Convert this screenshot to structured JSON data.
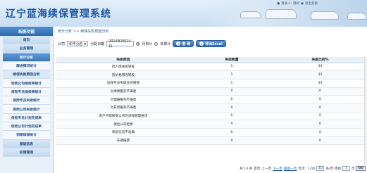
{
  "app": {
    "title": "辽宁蓝海续保管理系统"
  },
  "header_links": {
    "welcome": "登录人: 测试",
    "logout": "退出系统"
  },
  "sidebar": {
    "title": "系统功能",
    "items": [
      {
        "label": "首页",
        "kind": "group"
      },
      {
        "label": "业务管理",
        "kind": "group"
      },
      {
        "label": "统计分析",
        "kind": "active"
      },
      {
        "label": "跟进情况统计",
        "kind": "sub"
      },
      {
        "label": "续保失败原因分析",
        "kind": "sub-active"
      },
      {
        "label": "保险公司续保率统计",
        "kind": "sub"
      },
      {
        "label": "保险专员续保率统计",
        "kind": "sub"
      },
      {
        "label": "保险专员失败统计",
        "kind": "sub"
      },
      {
        "label": "保险公司失败统计",
        "kind": "sub"
      },
      {
        "label": "保险专员计划完成率",
        "kind": "sub"
      },
      {
        "label": "保险公司计划完成率",
        "kind": "sub"
      },
      {
        "label": "到期续保统计",
        "kind": "sub"
      },
      {
        "label": "基础信息",
        "kind": "group"
      },
      {
        "label": "权限管理",
        "kind": "group"
      }
    ]
  },
  "breadcrumb": {
    "parent": "统计分析",
    "sep": ">>",
    "current": "续保失败原因分析"
  },
  "filter": {
    "company_label": "公司",
    "company_value": "和平分店",
    "date_label": "分配日期",
    "date_value": "2014年3月24日",
    "mode_month": "月累计",
    "mode_year": "年累计",
    "search_btn": "查 询",
    "export_btn": "导出Excel"
  },
  "table": {
    "headers": [
      "失败原因",
      "失败数量",
      "失败比例%"
    ],
    "rows": [
      [
        "因人情关系转投",
        "1",
        "33"
      ],
      [
        "因价格原因转投",
        "1",
        "33"
      ],
      [
        "续保专员失职业务脱落",
        "1",
        "33"
      ],
      [
        "对承保服务不满意",
        "0",
        "0"
      ],
      [
        "对理赔服务不满意",
        "0",
        "0"
      ],
      [
        "对日常服务不满意",
        "0",
        "0"
      ],
      [
        "客户不能接受公司的承保管理要求",
        "0",
        "0"
      ],
      [
        "保险公司拒保",
        "0",
        "0"
      ],
      [
        "系统信息不准确",
        "0",
        "0"
      ],
      [
        "车辆报废",
        "0",
        "0"
      ]
    ]
  },
  "pager": {
    "total": "共 13 条",
    "first": "首页",
    "prev": "上一页",
    "next": "下一页",
    "last": "最后一页",
    "page_info": "页次：1/10",
    "per_page_value": "10",
    "per_page_label": "条/页 转到",
    "goto_value": "1",
    "goto_suffix": "页",
    "go_btn": "GO"
  },
  "colors": {
    "brand": "#1f57a4",
    "sidebar_active": "#3b78bb",
    "header_bg": "#c9def2"
  }
}
